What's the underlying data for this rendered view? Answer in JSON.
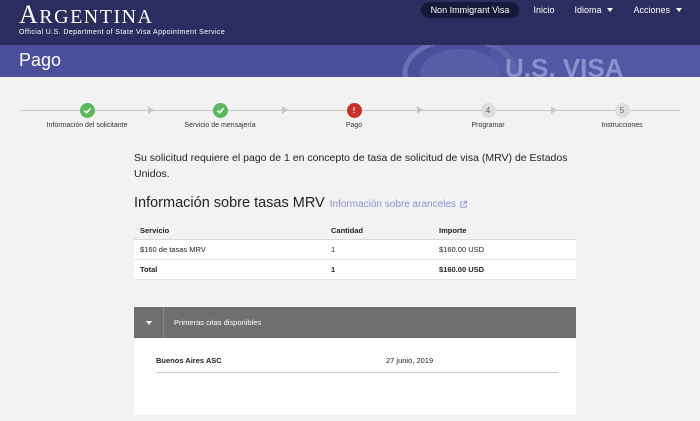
{
  "header": {
    "country_first": "A",
    "country_rest": "RGENTINA",
    "subtitle": "Official U.S. Department of State Visa Appointment Service",
    "nav": {
      "visa_type": "Non Immigrant Visa",
      "home": "Inicio",
      "language": "Idioma",
      "actions": "Acciones"
    }
  },
  "banner": {
    "title": "Pago",
    "watermark": "U.S. VISA"
  },
  "steps": [
    {
      "label": "Información del solicitante",
      "state": "done",
      "mark": "✓"
    },
    {
      "label": "Servicio de mensajería",
      "state": "done",
      "mark": "✓"
    },
    {
      "label": "Pago",
      "state": "active",
      "mark": "!"
    },
    {
      "label": "Programar",
      "state": "todo",
      "mark": "4"
    },
    {
      "label": "Instrucciones",
      "state": "todo",
      "mark": "5"
    }
  ],
  "intro": "Su solicitud requiere el pago de 1 en concepto de tasa de solicitud de visa (MRV) de Estados Unidos.",
  "fees": {
    "title": "Información sobre tasas MRV",
    "link": "Información sobre aranceles",
    "headers": {
      "service": "Servicio",
      "qty": "Cantidad",
      "amount": "Importe"
    },
    "row": {
      "service": "$160 de tasas MRV",
      "qty": "1",
      "amount": "$160.00 USD"
    },
    "total": {
      "label": "Total",
      "qty": "1",
      "amount": "$160.00 USD"
    }
  },
  "appointments": {
    "title": "Primeras citas disponibles",
    "location": "Buenos Aires ASC",
    "date": "27 junio, 2019"
  },
  "colors": {
    "header": "#2b2d5e",
    "banner": "#4b4f9c",
    "done": "#5cb85c",
    "active": "#c9302c",
    "link": "#8a8fd0"
  }
}
